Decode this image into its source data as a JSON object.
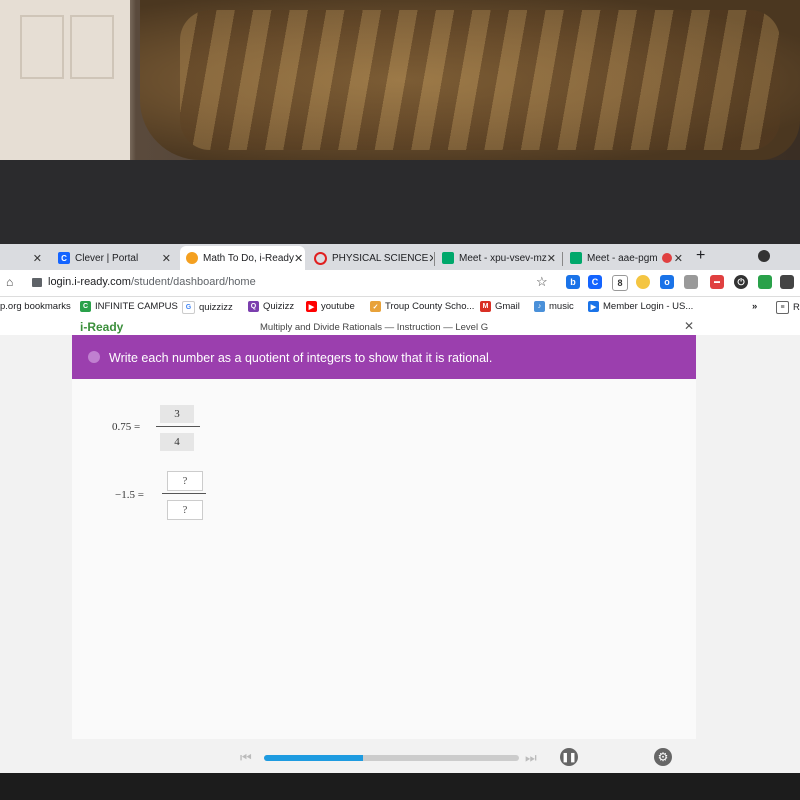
{
  "browser": {
    "tabs": [
      {
        "label": "",
        "favicon": "generic",
        "color": "#444444",
        "active": false
      },
      {
        "label": "Clever | Portal",
        "favicon": "C",
        "color": "#1464ff",
        "active": false
      },
      {
        "label": "Math To Do, i-Ready",
        "favicon": "i",
        "color": "#f4a020",
        "active": true
      },
      {
        "label": "PHYSICAL SCIENCE",
        "favicon": "O",
        "color": "#e02020",
        "active": false
      },
      {
        "label": "Meet - xpu-vsev-mz",
        "favicon": "M",
        "color": "#00a86b",
        "active": false
      },
      {
        "label": "Meet - aae-pgm",
        "favicon": "M",
        "color": "#00a86b",
        "active": false
      }
    ],
    "new_tab_label": "+",
    "close_glyph": "✕",
    "url_host": "login.i-ready.com",
    "url_path": "/student/dashboard/home",
    "star_glyph": "☆",
    "bookmarks": [
      {
        "label": "p.org bookmarks",
        "icon": ""
      },
      {
        "label": "INFINITE CAMPUS",
        "icon": "C",
        "color": "#2aa14a"
      },
      {
        "label": "quizzizz",
        "icon": "G",
        "color": "#4285f4"
      },
      {
        "label": "Quizizz",
        "icon": "Q",
        "color": "#7b3fae"
      },
      {
        "label": "youtube",
        "icon": "▶",
        "color": "#ff0000"
      },
      {
        "label": "Troup County Scho...",
        "icon": "✓",
        "color": "#e8a23a"
      },
      {
        "label": "Gmail",
        "icon": "M",
        "color": "#d93025"
      },
      {
        "label": "music",
        "icon": "♪",
        "color": "#4a90d9"
      },
      {
        "label": "Member Login - US...",
        "icon": "▶",
        "color": "#1a73e8"
      }
    ],
    "more_bookmarks": "»",
    "reading_list": "Re"
  },
  "lesson": {
    "logo": "i-Ready",
    "title": "Multiply and Divide Rationals — Instruction — Level G",
    "close_glyph": "✕",
    "prompt": "Write each number as a quotient of integers to show that it is rational.",
    "problems": [
      {
        "lhs": "0.75 =",
        "numerator": "3",
        "denominator": "4",
        "answered": true
      },
      {
        "lhs": "−1.5 =",
        "numerator": "?",
        "denominator": "?",
        "answered": false
      }
    ]
  },
  "player": {
    "skip_back": "⏮",
    "skip_forward": "⏭",
    "progress_percent": 39,
    "pause_glyph": "❚❚",
    "settings_glyph": "⚙"
  }
}
